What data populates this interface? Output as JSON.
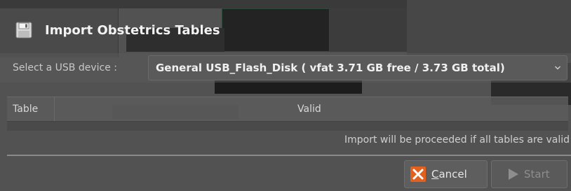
{
  "dialog": {
    "title": "Import Obstetrics Tables",
    "title_icon": "floppy-disk-icon"
  },
  "usb": {
    "label": "Select a USB device :",
    "selected": "General USB_Flash_Disk ( vfat 3.71 GB free / 3.73 GB total)",
    "dropdown_icon": "chevron-down-icon"
  },
  "table": {
    "columns": [
      "Table",
      "Valid"
    ],
    "rows": []
  },
  "status": {
    "message": "Import will be proceeded if all tables are valid"
  },
  "buttons": {
    "cancel": {
      "mnemonic": "C",
      "rest": "ancel",
      "icon": "cancel-icon",
      "enabled": true
    },
    "start": {
      "label": "Start",
      "icon": "play-icon",
      "enabled": false
    }
  },
  "colors": {
    "cancel_icon": "#e2611f",
    "dialog_background": "#525252",
    "title_text": "#f2f2f2"
  }
}
